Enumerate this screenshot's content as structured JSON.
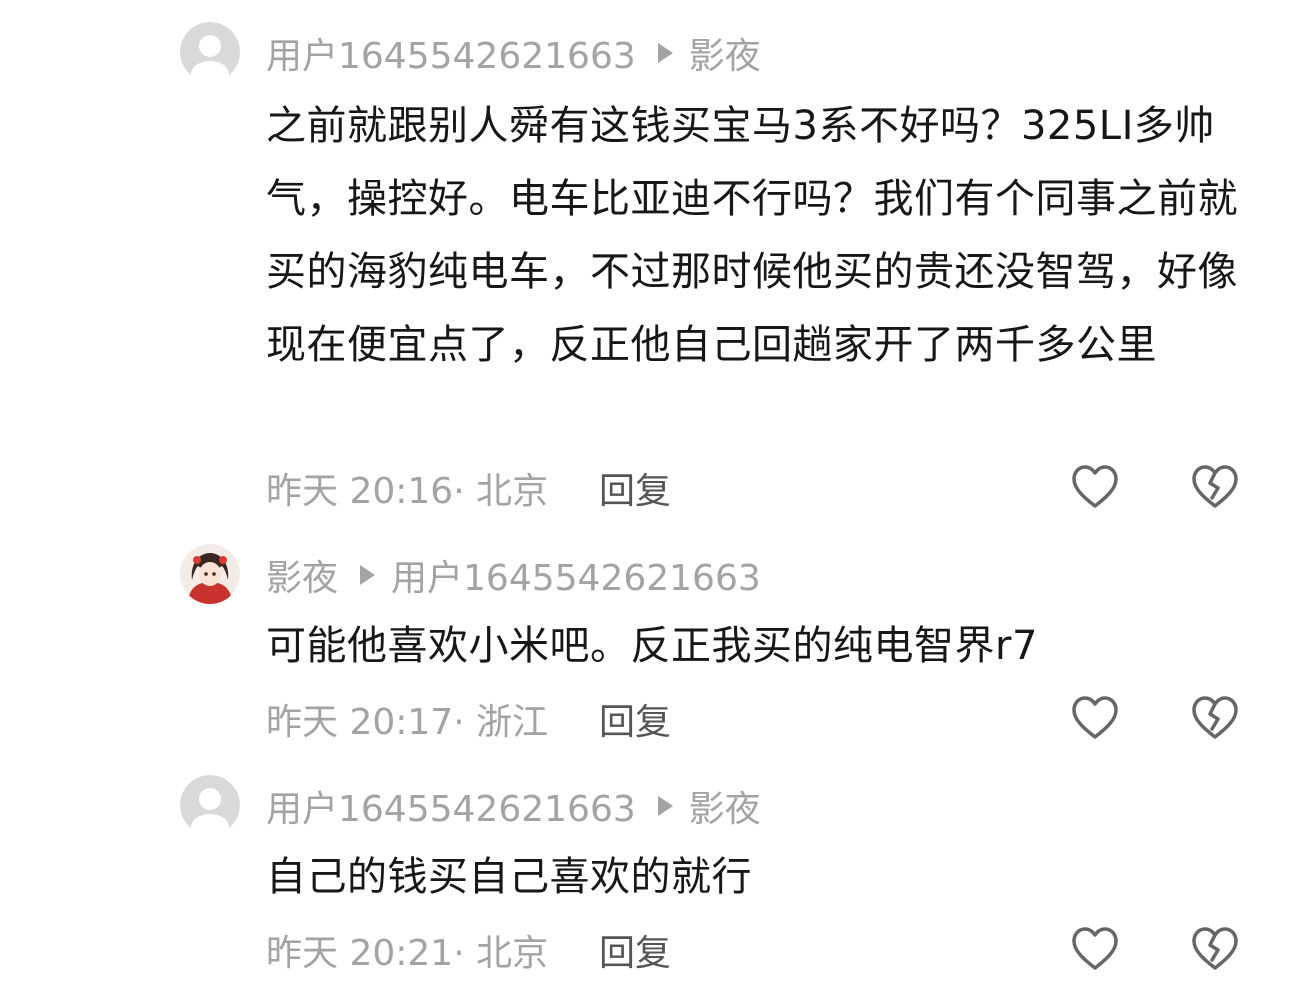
{
  "comments": [
    {
      "author": "用户1645542621663",
      "reply_to": "影夜",
      "avatar": "default-user-avatar",
      "text": "之前就跟别人舜有这钱买宝马3系不好吗？325LI多帅气，操控好。电车比亚迪不行吗？我们有个同事之前就买的海豹纯电车，不过那时候他买的贵还没智驾，好像现在便宜点了，反正他自己回趟家开了两千多公里",
      "time_location": "昨天 20:16· 北京",
      "reply_label": "回复"
    },
    {
      "author": "影夜",
      "reply_to": "用户1645542621663",
      "avatar": "anime-girl-avatar",
      "text": "可能他喜欢小米吧。反正我买的纯电智界r7",
      "time_location": "昨天 20:17· 浙江",
      "reply_label": "回复"
    },
    {
      "author": "用户1645542621663",
      "reply_to": "影夜",
      "avatar": "default-user-avatar",
      "text": "自己的钱买自己喜欢的就行",
      "time_location": "昨天 20:21· 北京",
      "reply_label": "回复"
    }
  ],
  "icons": {
    "like": "heart-outline-icon",
    "dislike": "broken-heart-outline-icon",
    "reply_pointer": "triangle-right-icon"
  },
  "colors": {
    "text_primary": "#171717",
    "text_secondary": "#a3a3a3",
    "reply_button": "#555555",
    "icon_stroke": "#666666",
    "avatar_default_bg": "#d9d9d9"
  }
}
